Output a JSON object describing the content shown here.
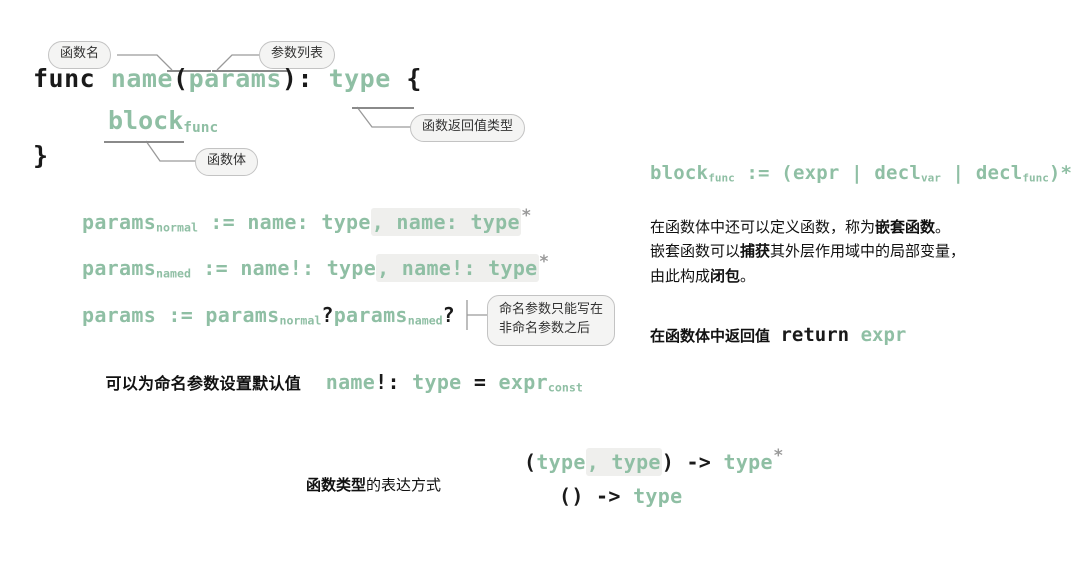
{
  "palette": {
    "green": "#8fbfa4",
    "ink": "#1a1a1a",
    "bubble_bg": "#f4f4f3",
    "bubble_border": "#c3c3c3",
    "highlight": "#efefed",
    "star_gray": "#9a9a9a",
    "background": "#ffffff"
  },
  "signature": {
    "kw_func": "func",
    "name": "name",
    "paren_open": "(",
    "params": "params",
    "paren_close": ")",
    "colon": ":",
    "type": "type",
    "brace_open": "{",
    "block": "block",
    "block_sub": "func",
    "brace_close": "}"
  },
  "callouts": {
    "func_name": "函数名",
    "param_list": "参数列表",
    "return_type": "函数返回值类型",
    "func_body": "函数体",
    "named_param_note": "命名参数只能写在\n非命名参数之后"
  },
  "rules": {
    "normal": {
      "lhs": "params",
      "lhs_sub": "normal",
      "op": ":=",
      "plain": "name: type",
      "repeat": ", name: type",
      "star": "*"
    },
    "named": {
      "lhs": "params",
      "lhs_sub": "named",
      "op": ":=",
      "plain": "name!: type",
      "repeat": ", name!: type",
      "star": "*"
    },
    "combined": {
      "lhs": "params",
      "op": ":=",
      "part1": "params",
      "part1_sub": "normal",
      "opt1": "?",
      "part2": "params",
      "part2_sub": "named",
      "opt2": "?"
    },
    "default_value": {
      "label": "可以为命名参数设置默认值",
      "code_name": "name",
      "code_bang": "!",
      "code_colon": ":",
      "code_type": "type",
      "code_eq": "=",
      "code_expr": "expr",
      "code_expr_sub": "const"
    }
  },
  "right": {
    "block_rule": {
      "lhs": "block",
      "lhs_sub": "func",
      "op": ":=",
      "open": "(",
      "expr": "expr",
      "bar1": "|",
      "decl_var": "decl",
      "decl_var_sub": "var",
      "bar2": "|",
      "decl_func": "decl",
      "decl_func_sub": "func",
      "close": ")",
      "star": "*"
    },
    "paragraph_html": "在函数体中还可以定义函数，称为<b>嵌套函数</b>。\n嵌套函数可以<b>捕获</b>其外层作用域中的局部变量，\n由此构成<b>闭包</b>。",
    "return_line": {
      "label": "在函数体中",
      "label_bold": "返回值",
      "kw": "return",
      "expr": "expr"
    }
  },
  "bottom": {
    "label_bold": "函数类型",
    "label_rest": "的表达方式",
    "line1": {
      "open": "(",
      "type1": "type",
      "repeat": ", type",
      "close": ")",
      "arrow": "->",
      "ret": "type",
      "star": "*"
    },
    "line2": {
      "empty_parens": "()",
      "arrow": "->",
      "ret": "type"
    }
  }
}
